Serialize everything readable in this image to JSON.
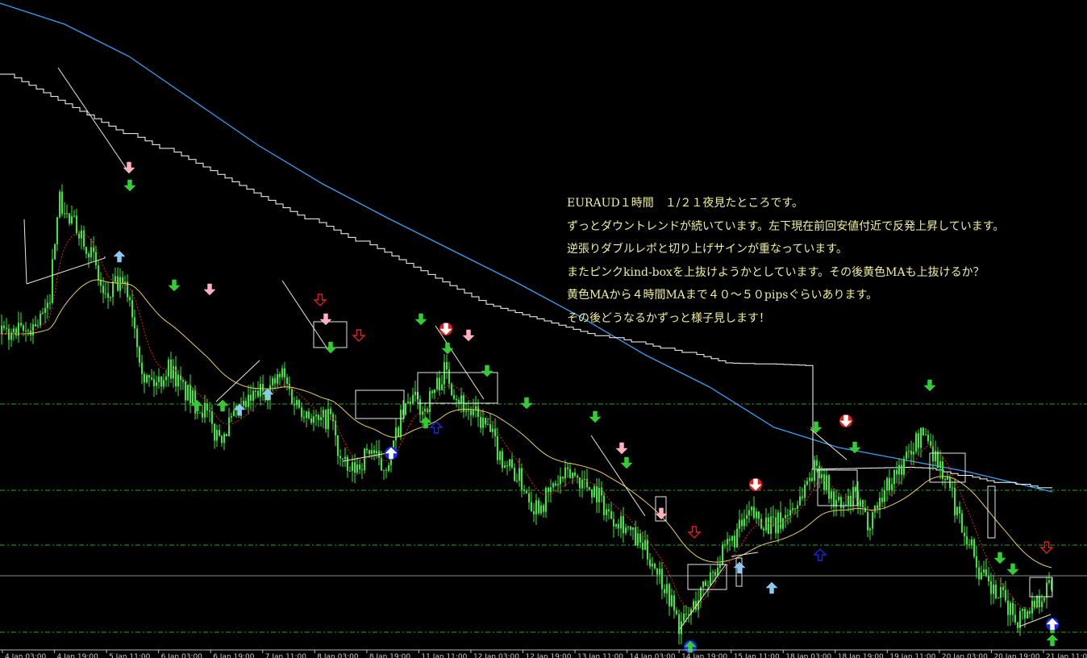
{
  "chart_data": {
    "type": "line",
    "title": "",
    "xlabel": "",
    "ylabel": "",
    "x_ticks": [
      "4 Jan 03:00",
      "4 Jan 19:00",
      "5 Jan 11:00",
      "6 Jan 03:00",
      "6 Jan 19:00",
      "7 Jan 11:00",
      "8 Jan 03:00",
      "8 Jan 19:00",
      "11 Jan 11:00",
      "12 Jan 03:00",
      "12 Jan 19:00",
      "13 Jan 11:00",
      "14 Jan 03:00",
      "14 Jan 19:00",
      "15 Jan 11:00",
      "18 Jan 03:00",
      "18 Jan 19:00",
      "19 Jan 11:00",
      "20 Jan 03:00",
      "20 Jan 19:00",
      "21 Jan 11:00"
    ],
    "grid": false,
    "legend": "none",
    "colors": {
      "background": "#000000",
      "candles": "#33ee33",
      "ma_fast": "#dd2222",
      "ma_yellow": "#e8d060",
      "ma_4h_step": "#ffffff",
      "ma_long": "#3aa0f0",
      "level_lines": "#22aa22",
      "current_price_line": "#8a8a8a",
      "annotation_text": "#f2f09a"
    },
    "price_path": [
      [
        0,
        0.55
      ],
      [
        30,
        0.55
      ],
      [
        60,
        0.6
      ],
      [
        72,
        0.85
      ],
      [
        85,
        0.8
      ],
      [
        100,
        0.78
      ],
      [
        115,
        0.72
      ],
      [
        130,
        0.62
      ],
      [
        145,
        0.66
      ],
      [
        160,
        0.64
      ],
      [
        172,
        0.52
      ],
      [
        180,
        0.45
      ],
      [
        195,
        0.44
      ],
      [
        210,
        0.48
      ],
      [
        225,
        0.43
      ],
      [
        240,
        0.4
      ],
      [
        255,
        0.38
      ],
      [
        265,
        0.33
      ],
      [
        275,
        0.33
      ],
      [
        290,
        0.36
      ],
      [
        305,
        0.39
      ],
      [
        320,
        0.42
      ],
      [
        335,
        0.43
      ],
      [
        350,
        0.46
      ],
      [
        365,
        0.4
      ],
      [
        380,
        0.38
      ],
      [
        395,
        0.35
      ],
      [
        410,
        0.37
      ],
      [
        420,
        0.28
      ],
      [
        432,
        0.24
      ],
      [
        445,
        0.26
      ],
      [
        460,
        0.3
      ],
      [
        472,
        0.25
      ],
      [
        485,
        0.28
      ],
      [
        495,
        0.35
      ],
      [
        510,
        0.41
      ],
      [
        525,
        0.38
      ],
      [
        540,
        0.43
      ],
      [
        552,
        0.47
      ],
      [
        565,
        0.42
      ],
      [
        580,
        0.38
      ],
      [
        595,
        0.36
      ],
      [
        608,
        0.33
      ],
      [
        620,
        0.28
      ],
      [
        635,
        0.25
      ],
      [
        648,
        0.22
      ],
      [
        662,
        0.17
      ],
      [
        675,
        0.18
      ],
      [
        690,
        0.22
      ],
      [
        710,
        0.24
      ],
      [
        725,
        0.22
      ],
      [
        740,
        0.2
      ],
      [
        755,
        0.15
      ],
      [
        770,
        0.14
      ],
      [
        785,
        0.1
      ],
      [
        800,
        0.07
      ],
      [
        815,
        0.03
      ],
      [
        830,
        -0.03
      ],
      [
        843,
        -0.1
      ],
      [
        855,
        -0.07
      ],
      [
        870,
        -0.02
      ],
      [
        885,
        0.03
      ],
      [
        900,
        0.07
      ],
      [
        915,
        0.11
      ],
      [
        930,
        0.15
      ],
      [
        945,
        0.14
      ],
      [
        960,
        0.12
      ],
      [
        975,
        0.15
      ],
      [
        990,
        0.18
      ],
      [
        1005,
        0.24
      ],
      [
        1015,
        0.26
      ],
      [
        1030,
        0.19
      ],
      [
        1045,
        0.16
      ],
      [
        1060,
        0.19
      ],
      [
        1075,
        0.13
      ],
      [
        1090,
        0.18
      ],
      [
        1105,
        0.23
      ],
      [
        1120,
        0.26
      ],
      [
        1135,
        0.31
      ],
      [
        1148,
        0.33
      ],
      [
        1160,
        0.28
      ],
      [
        1175,
        0.22
      ],
      [
        1190,
        0.14
      ],
      [
        1205,
        0.08
      ],
      [
        1215,
        0.02
      ],
      [
        1230,
        -0.02
      ],
      [
        1245,
        -0.04
      ],
      [
        1260,
        -0.08
      ],
      [
        1275,
        -0.06
      ],
      [
        1290,
        -0.03
      ],
      [
        1305,
        0.0
      ]
    ],
    "note": [
      "EURAUD１時間　１/２１夜見たところです。",
      "ずっとダウントレンドが続いています。左下現在前回安値付近で反発上昇しています。",
      "逆張りダブルレポと切り上げサインが重なっています。",
      "またピンクkind-boxを上抜けようかとしています。その後黄色MAも上抜けるか？",
      "黄色MAから４時間MAまで４０～５０pipsぐらいあります。",
      "その後どうなるかずっと様子見します！"
    ]
  }
}
